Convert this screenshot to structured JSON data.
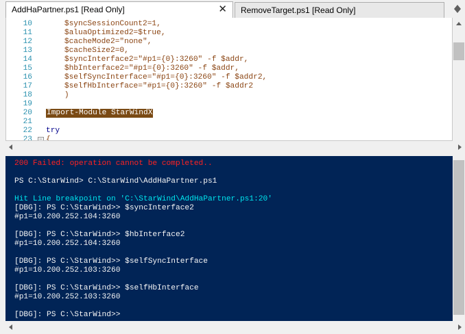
{
  "tabs": [
    {
      "label": "AddHaPartner.ps1 [Read Only]",
      "close": "✕",
      "active": true
    },
    {
      "label": "RemoveTarget.ps1 [Read Only]",
      "active": false
    }
  ],
  "icons": {
    "tab_overflow": "tab-overflow-icon",
    "fold": "collapse-icon"
  },
  "editor": {
    "lines": [
      {
        "num": "10",
        "text": "    $syncSessionCount2=1,"
      },
      {
        "num": "11",
        "text": "    $aluaOptimized2=$true,"
      },
      {
        "num": "12",
        "text": "    $cacheMode2=\"none\","
      },
      {
        "num": "13",
        "text": "    $cacheSize2=0,"
      },
      {
        "num": "14",
        "text": "    $syncInterface2=\"#p1={0}:3260\" -f $addr,"
      },
      {
        "num": "15",
        "text": "    $hbInterface2=\"#p1={0}:3260\" -f $addr,"
      },
      {
        "num": "16",
        "text": "    $selfSyncInterface=\"#p1={0}:3260\" -f $addr2,"
      },
      {
        "num": "17",
        "text": "    $selfHbInterface=\"#p1={0}:3260\" -f $addr2"
      },
      {
        "num": "18",
        "text": "    )"
      },
      {
        "num": "19",
        "text": ""
      },
      {
        "num": "20",
        "text": "Import-Module StarWindX"
      },
      {
        "num": "21",
        "text": ""
      },
      {
        "num": "22",
        "text": "try"
      },
      {
        "num": "23",
        "text": "{",
        "fold": "−"
      }
    ]
  },
  "console": {
    "lines": [
      {
        "text": "200 Failed: operation cannot be completed..",
        "kind": "err"
      },
      {
        "text": "",
        "kind": "out"
      },
      {
        "text": "PS C:\\StarWind> C:\\StarWind\\AddHaPartner.ps1",
        "kind": "out"
      },
      {
        "text": "",
        "kind": "out"
      },
      {
        "text": "Hit Line breakpoint on 'C:\\StarWind\\AddHaPartner.ps1:20'",
        "kind": "dbg"
      },
      {
        "text": "[DBG]: PS C:\\StarWind>> $syncInterface2",
        "kind": "out"
      },
      {
        "text": "#p1=10.200.252.104:3260",
        "kind": "out"
      },
      {
        "text": "",
        "kind": "out"
      },
      {
        "text": "[DBG]: PS C:\\StarWind>> $hbInterface2",
        "kind": "out"
      },
      {
        "text": "#p1=10.200.252.104:3260",
        "kind": "out"
      },
      {
        "text": "",
        "kind": "out"
      },
      {
        "text": "[DBG]: PS C:\\StarWind>> $selfSyncInterface",
        "kind": "out"
      },
      {
        "text": "#p1=10.200.252.103:3260",
        "kind": "out"
      },
      {
        "text": "",
        "kind": "out"
      },
      {
        "text": "[DBG]: PS C:\\StarWind>> $selfHbInterface",
        "kind": "out"
      },
      {
        "text": "#p1=10.200.252.103:3260",
        "kind": "out"
      },
      {
        "text": "",
        "kind": "out"
      },
      {
        "text": "[DBG]: PS C:\\StarWind>>",
        "kind": "out"
      }
    ]
  },
  "colors": {
    "console_bg": "#012456",
    "error": "#ff2222",
    "debug": "#00e5ee",
    "string": "#8b4513",
    "keyword": "#00008b",
    "highlight": "#7a4a14",
    "line_number": "#2b91af"
  }
}
